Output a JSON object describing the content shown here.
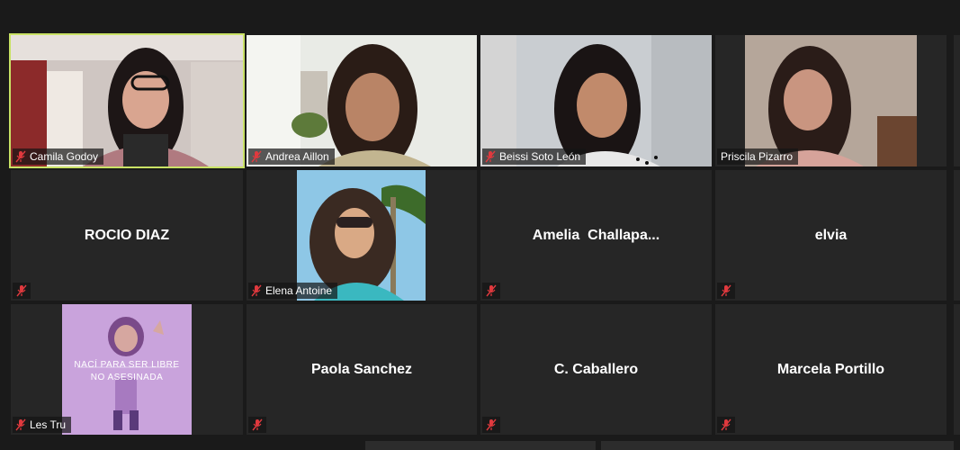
{
  "participants": [
    {
      "name": "Camila Godoy",
      "muted": true,
      "video": true,
      "active": true
    },
    {
      "name": "Andrea Aillon",
      "muted": true,
      "video": true
    },
    {
      "name": "Beissi Soto León",
      "muted": true,
      "video": true
    },
    {
      "name": "Priscila Pizarro",
      "muted": false,
      "video": true
    },
    {
      "name": "ROCIO DIAZ",
      "muted": true,
      "video": false
    },
    {
      "name": "Elena Antoine",
      "muted": true,
      "video": true
    },
    {
      "name": "Amelia  Challapa...",
      "muted": true,
      "video": false
    },
    {
      "name": "elvia",
      "muted": true,
      "video": false
    },
    {
      "name": "Les Tru",
      "muted": true,
      "video": true
    },
    {
      "name": "Paola Sanchez",
      "muted": true,
      "video": false
    },
    {
      "name": "C. Caballero",
      "muted": true,
      "video": false
    },
    {
      "name": "Marcela Portillo",
      "muted": true,
      "video": false
    }
  ],
  "poster": {
    "line1": "NACÍ PARA SER LIBRE",
    "line2": "NO ASESINADA"
  },
  "colors": {
    "active_border": "#c9e265",
    "mute_red": "#e0393e",
    "tile_bg": "#262626"
  }
}
